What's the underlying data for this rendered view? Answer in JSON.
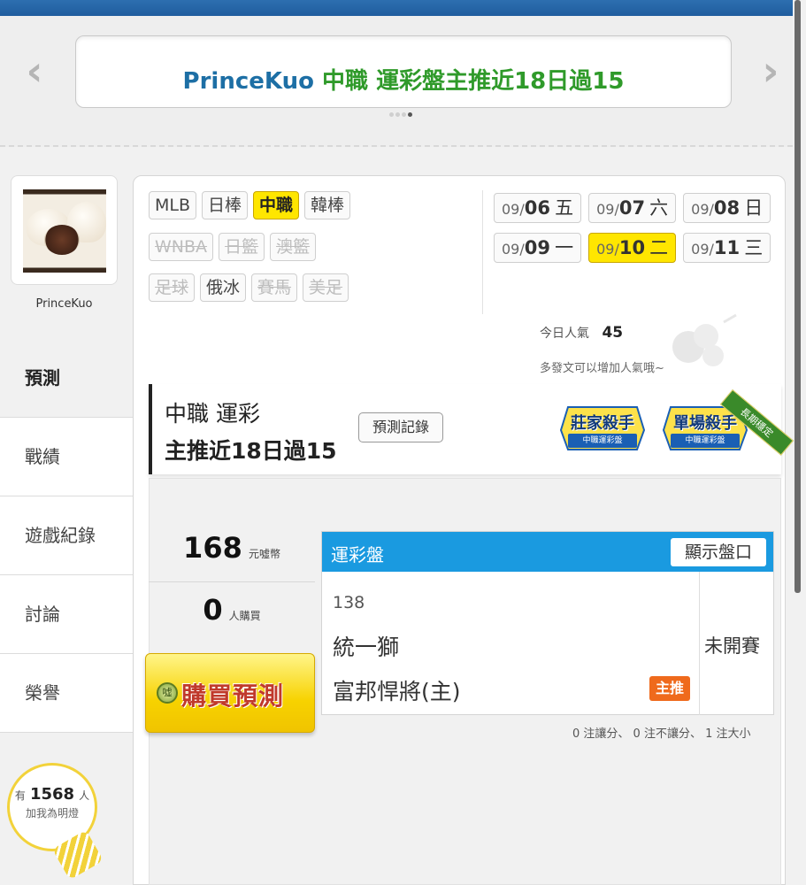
{
  "banner": {
    "author": "PrinceKuo",
    "headline": "中職 運彩盤主推近18日過15"
  },
  "profile": {
    "name": "PrinceKuo"
  },
  "sidebar": {
    "items": [
      {
        "label": "預測",
        "active": true
      },
      {
        "label": "戰績",
        "active": false
      },
      {
        "label": "遊戲紀錄",
        "active": false
      },
      {
        "label": "討論",
        "active": false
      },
      {
        "label": "榮譽",
        "active": false
      }
    ]
  },
  "fans": {
    "prefix": "有",
    "count": "1568",
    "suffix": "人",
    "line2": "加我為明燈"
  },
  "leagues": {
    "row1": [
      {
        "label": "MLB",
        "state": "normal"
      },
      {
        "label": "日棒",
        "state": "normal"
      },
      {
        "label": "中職",
        "state": "active"
      },
      {
        "label": "韓棒",
        "state": "normal"
      }
    ],
    "row2": [
      {
        "label": "WNBA",
        "state": "disabled"
      },
      {
        "label": "日籃",
        "state": "disabled"
      },
      {
        "label": "澳籃",
        "state": "disabled"
      }
    ],
    "row3": [
      {
        "label": "足球",
        "state": "disabled"
      },
      {
        "label": "俄冰",
        "state": "normal"
      },
      {
        "label": "賽馬",
        "state": "disabled"
      },
      {
        "label": "美足",
        "state": "disabled"
      }
    ]
  },
  "dates": {
    "row1": [
      {
        "month": "09/",
        "day": "06",
        "weekday": "五",
        "active": false
      },
      {
        "month": "09/",
        "day": "07",
        "weekday": "六",
        "active": false
      },
      {
        "month": "09/",
        "day": "08",
        "weekday": "日",
        "active": false
      }
    ],
    "row2": [
      {
        "month": "09/",
        "day": "09",
        "weekday": "一",
        "active": false
      },
      {
        "month": "09/",
        "day": "10",
        "weekday": "二",
        "active": true
      },
      {
        "month": "09/",
        "day": "11",
        "weekday": "三",
        "active": false
      }
    ]
  },
  "popularity": {
    "label": "今日人氣",
    "value": "45",
    "hint": "多發文可以增加人氣哦~"
  },
  "prediction": {
    "line1": "中職 運彩",
    "line2": "主推近18日過15",
    "record_button": "預測記錄",
    "badges": [
      {
        "title": "莊家殺手",
        "sub": "中職運彩盤"
      },
      {
        "title": "單場殺手",
        "sub": "中職運彩盤"
      }
    ],
    "ribbon": "長期穩定"
  },
  "price": {
    "value": "168",
    "unit": "元噓幣"
  },
  "buyers": {
    "value": "0",
    "unit": "人購買"
  },
  "buy_button": {
    "label": "購買預測",
    "coin": "噓"
  },
  "game": {
    "header": "運彩盤",
    "show_button": "顯示盤口",
    "id": "138",
    "away": "統一獅",
    "home": "富邦悍將(主)",
    "pick_tag": "主推",
    "status": "未開賽"
  },
  "bet_summary": "0 注讓分、 0 注不讓分、 1 注大小",
  "colors": {
    "accent_blue": "#1a9ae0",
    "active_yellow": "#ffe600",
    "pick_orange": "#ef6a1c",
    "title_green": "#2f9a2a"
  }
}
